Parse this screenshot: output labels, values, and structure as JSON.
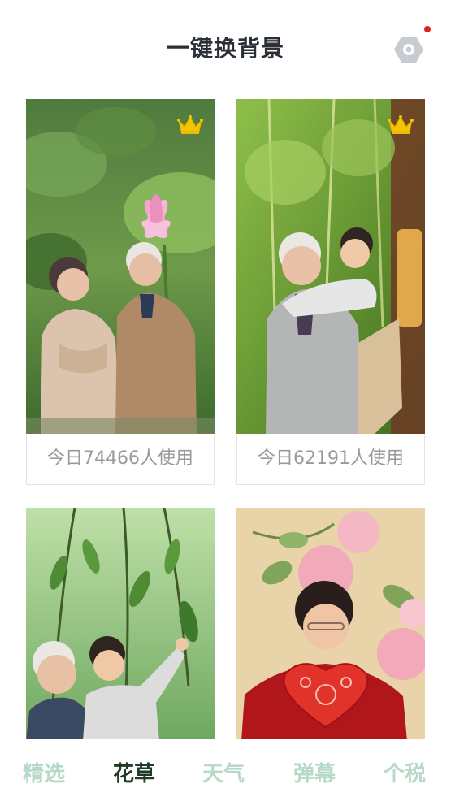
{
  "header": {
    "title": "一键换背景"
  },
  "cards": [
    {
      "usage_text": "今日74466人使用"
    },
    {
      "usage_text": "今日62191人使用"
    }
  ],
  "tabs": [
    {
      "label": "精选"
    },
    {
      "label": "花草"
    },
    {
      "label": "天气"
    },
    {
      "label": "弹幕"
    },
    {
      "label": "个税"
    }
  ],
  "active_tab": "花草",
  "colors": {
    "title": "#2b2f36",
    "tab_inactive": "#b7d9c7",
    "tab_active": "#1f3a26",
    "badge_red": "#e02020",
    "crown_gold": "#f5c400"
  },
  "icons": [
    "settings-icon",
    "crown-icon"
  ]
}
